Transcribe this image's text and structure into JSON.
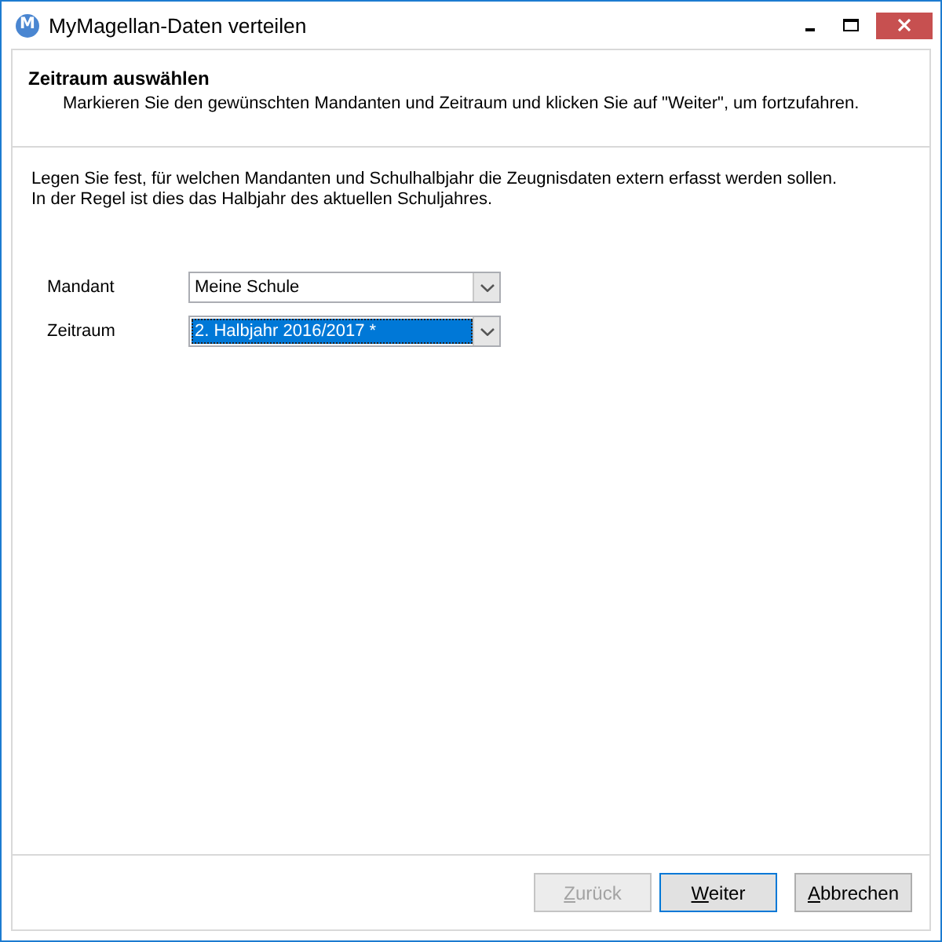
{
  "window": {
    "title": "MyMagellan-Daten verteilen",
    "icon_letter": "M"
  },
  "header": {
    "title": "Zeitraum auswählen",
    "subtitle": "Markieren Sie den gewünschten Mandanten und Zeitraum und klicken Sie auf \"Weiter\", um fortzufahren."
  },
  "intro": [
    "Legen Sie fest, für welchen Mandanten und Schulhalbjahr die Zeugnisdaten extern erfasst werden sollen.",
    "In der Regel ist dies das Halbjahr des aktuellen Schuljahres."
  ],
  "fields": [
    {
      "label": "Mandant",
      "value": "Meine Schule",
      "focused": false
    },
    {
      "label": "Zeitraum",
      "value": "2. Halbjahr 2016/2017 *",
      "focused": true
    }
  ],
  "buttons": [
    {
      "label": "Zurück",
      "disabled": true,
      "default": false
    },
    {
      "label": "Weiter",
      "disabled": false,
      "default": true
    },
    {
      "label": "Abbrechen",
      "disabled": false,
      "default": false
    }
  ]
}
